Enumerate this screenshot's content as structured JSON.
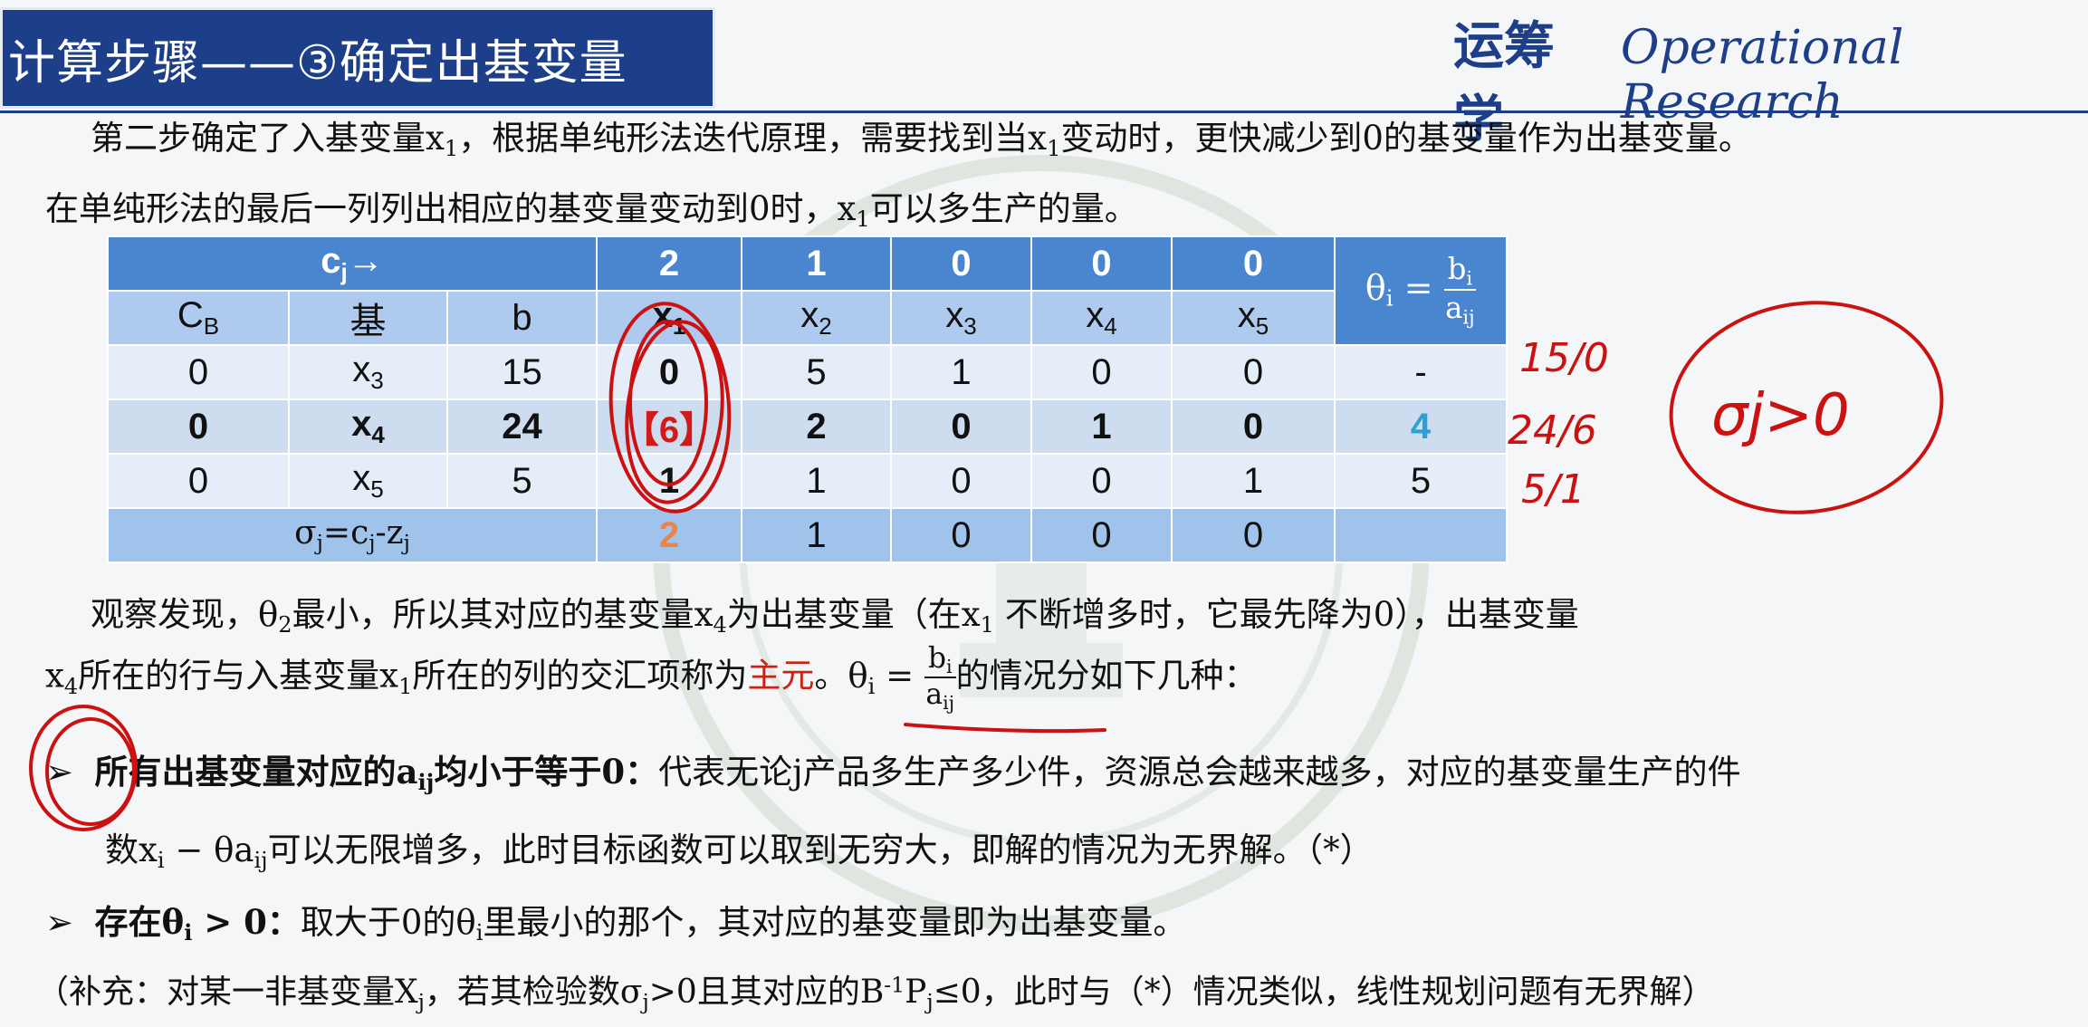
{
  "header": {
    "title": "计算步骤——③确定出基变量",
    "brand_cn": "运筹学",
    "brand_en": "Operational Research"
  },
  "para1": {
    "a": "第二步确定了入基变量x",
    "a_sub": "1",
    "b": "，根据单纯形法迭代原理，需要找到当x",
    "b_sub": "1",
    "c": "变动时，更快减少到0的基变量作为出基变量。"
  },
  "para2": {
    "a": "在单纯形法的最后一列列出相应的基变量变动到0时，x",
    "a_sub": "1",
    "b": "可以多生产的量。"
  },
  "table": {
    "cj_label": "c",
    "cj_sub": "j",
    "cj_arrow": "→",
    "cj_values": [
      "2",
      "1",
      "0",
      "0",
      "0"
    ],
    "col_headers": [
      "C",
      "基",
      "b"
    ],
    "cb_sub": "B",
    "var_headers": [
      {
        "name": "x",
        "sub": "1"
      },
      {
        "name": "x",
        "sub": "2"
      },
      {
        "name": "x",
        "sub": "3"
      },
      {
        "name": "x",
        "sub": "4"
      },
      {
        "name": "x",
        "sub": "5"
      }
    ],
    "theta_header": {
      "lhs": "θ",
      "lhs_sub": "i",
      "eq": "=",
      "num": "b",
      "num_sub": "i",
      "den": "a",
      "den_sub": "ij"
    },
    "rows": [
      {
        "cb": "0",
        "basis": "x",
        "basis_sub": "3",
        "b": "15",
        "vals": [
          "0",
          "5",
          "1",
          "0",
          "0"
        ],
        "theta": "-"
      },
      {
        "cb": "0",
        "basis": "x",
        "basis_sub": "4",
        "b": "24",
        "vals": [
          "【6】",
          "2",
          "0",
          "1",
          "0"
        ],
        "theta": "4"
      },
      {
        "cb": "0",
        "basis": "x",
        "basis_sub": "5",
        "b": "5",
        "vals": [
          "1",
          "1",
          "0",
          "0",
          "1"
        ],
        "theta": "5"
      }
    ],
    "sigma_label": "σ",
    "sigma_sub": "j",
    "sigma_eq": "=c",
    "sigma_c_sub": "j",
    "sigma_minus": "-z",
    "sigma_z_sub": "j",
    "sigma_values": [
      "2",
      "1",
      "0",
      "0",
      "0"
    ]
  },
  "para3": {
    "a": "观察发现，θ",
    "a_sub": "2",
    "b": "最小，所以其对应的基变量x",
    "b_sub": "4",
    "c": "为出基变量（在x",
    "c_sub": "1",
    "d": " 不断增多时，它最先降为0），出基变量"
  },
  "para4": {
    "a": "x",
    "a_sub": "4",
    "b": "所在的行与入基变量x",
    "b_sub": "1",
    "c": "所在的列的交汇项称为",
    "pivot_term": "主元",
    "d": "。θ",
    "d_sub": "i",
    "e": " = ",
    "frac_num": "b",
    "frac_num_sub": "i",
    "frac_den": "a",
    "frac_den_sub": "ij",
    "f": "的情况分如下几种："
  },
  "bullet1": {
    "marker": "➢",
    "bold_a": "所有出基变量对应的a",
    "bold_sub": "ij",
    "bold_b": "均小于等于0：",
    "text": "代表无论j产品多生产多少件，资源总会越来越多，对应的基变量生产的件",
    "line2_a": "数x",
    "line2_sub1": "i",
    "line2_b": " − θa",
    "line2_sub2": "ij",
    "line2_c": "可以无限增多，此时目标函数可以取到无穷大，即解的情况为无界解。（*）"
  },
  "bullet2": {
    "marker": "➢",
    "bold_a": "存在θ",
    "bold_sub": "i",
    "bold_b": " > 0：",
    "text_a": "取大于0的θ",
    "text_sub": "i",
    "text_b": "里最小的那个，其对应的基变量即为出基变量。"
  },
  "supplement": {
    "a": "（补充：对某一非基变量X",
    "a_sub": "j",
    "b": "，若其检验数σ",
    "b_sub": "j",
    "c": ">0且其对应的B",
    "c_sup": "-1",
    "d": "P",
    "d_sub": "j",
    "e": "≤0，此时与（*）情况类似，线性规划问题有无界解）"
  },
  "handwriting": {
    "notes": [
      "15/0",
      "24/6",
      "5/1"
    ],
    "circle_note": "σj>0"
  },
  "colors": {
    "title_bar": "#1d3f8a",
    "table_header": "#4a86cf",
    "table_subheader": "#aecbef",
    "pivot": "#d21a1a",
    "ink": "#cc1111",
    "theta_min": "#2aa0d8"
  }
}
